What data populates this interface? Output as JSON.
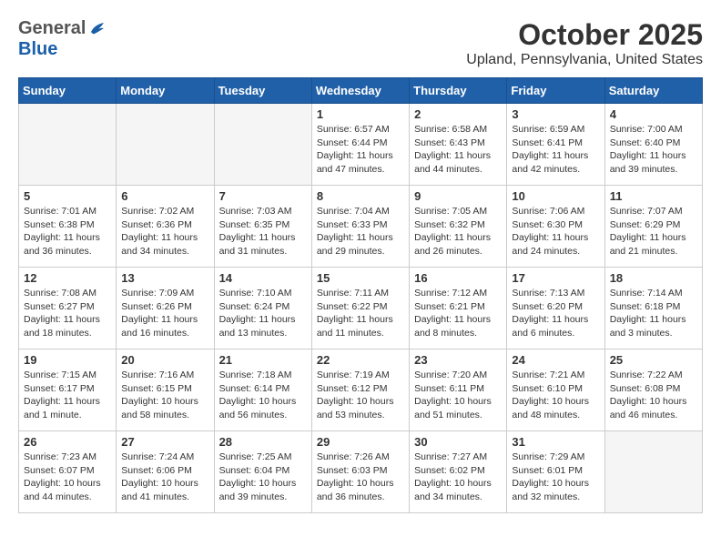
{
  "header": {
    "logo_general": "General",
    "logo_blue": "Blue",
    "month_title": "October 2025",
    "location": "Upland, Pennsylvania, United States"
  },
  "days_of_week": [
    "Sunday",
    "Monday",
    "Tuesday",
    "Wednesday",
    "Thursday",
    "Friday",
    "Saturday"
  ],
  "weeks": [
    [
      {
        "day": "",
        "info": ""
      },
      {
        "day": "",
        "info": ""
      },
      {
        "day": "",
        "info": ""
      },
      {
        "day": "1",
        "info": "Sunrise: 6:57 AM\nSunset: 6:44 PM\nDaylight: 11 hours\nand 47 minutes."
      },
      {
        "day": "2",
        "info": "Sunrise: 6:58 AM\nSunset: 6:43 PM\nDaylight: 11 hours\nand 44 minutes."
      },
      {
        "day": "3",
        "info": "Sunrise: 6:59 AM\nSunset: 6:41 PM\nDaylight: 11 hours\nand 42 minutes."
      },
      {
        "day": "4",
        "info": "Sunrise: 7:00 AM\nSunset: 6:40 PM\nDaylight: 11 hours\nand 39 minutes."
      }
    ],
    [
      {
        "day": "5",
        "info": "Sunrise: 7:01 AM\nSunset: 6:38 PM\nDaylight: 11 hours\nand 36 minutes."
      },
      {
        "day": "6",
        "info": "Sunrise: 7:02 AM\nSunset: 6:36 PM\nDaylight: 11 hours\nand 34 minutes."
      },
      {
        "day": "7",
        "info": "Sunrise: 7:03 AM\nSunset: 6:35 PM\nDaylight: 11 hours\nand 31 minutes."
      },
      {
        "day": "8",
        "info": "Sunrise: 7:04 AM\nSunset: 6:33 PM\nDaylight: 11 hours\nand 29 minutes."
      },
      {
        "day": "9",
        "info": "Sunrise: 7:05 AM\nSunset: 6:32 PM\nDaylight: 11 hours\nand 26 minutes."
      },
      {
        "day": "10",
        "info": "Sunrise: 7:06 AM\nSunset: 6:30 PM\nDaylight: 11 hours\nand 24 minutes."
      },
      {
        "day": "11",
        "info": "Sunrise: 7:07 AM\nSunset: 6:29 PM\nDaylight: 11 hours\nand 21 minutes."
      }
    ],
    [
      {
        "day": "12",
        "info": "Sunrise: 7:08 AM\nSunset: 6:27 PM\nDaylight: 11 hours\nand 18 minutes."
      },
      {
        "day": "13",
        "info": "Sunrise: 7:09 AM\nSunset: 6:26 PM\nDaylight: 11 hours\nand 16 minutes."
      },
      {
        "day": "14",
        "info": "Sunrise: 7:10 AM\nSunset: 6:24 PM\nDaylight: 11 hours\nand 13 minutes."
      },
      {
        "day": "15",
        "info": "Sunrise: 7:11 AM\nSunset: 6:22 PM\nDaylight: 11 hours\nand 11 minutes."
      },
      {
        "day": "16",
        "info": "Sunrise: 7:12 AM\nSunset: 6:21 PM\nDaylight: 11 hours\nand 8 minutes."
      },
      {
        "day": "17",
        "info": "Sunrise: 7:13 AM\nSunset: 6:20 PM\nDaylight: 11 hours\nand 6 minutes."
      },
      {
        "day": "18",
        "info": "Sunrise: 7:14 AM\nSunset: 6:18 PM\nDaylight: 11 hours\nand 3 minutes."
      }
    ],
    [
      {
        "day": "19",
        "info": "Sunrise: 7:15 AM\nSunset: 6:17 PM\nDaylight: 11 hours\nand 1 minute."
      },
      {
        "day": "20",
        "info": "Sunrise: 7:16 AM\nSunset: 6:15 PM\nDaylight: 10 hours\nand 58 minutes."
      },
      {
        "day": "21",
        "info": "Sunrise: 7:18 AM\nSunset: 6:14 PM\nDaylight: 10 hours\nand 56 minutes."
      },
      {
        "day": "22",
        "info": "Sunrise: 7:19 AM\nSunset: 6:12 PM\nDaylight: 10 hours\nand 53 minutes."
      },
      {
        "day": "23",
        "info": "Sunrise: 7:20 AM\nSunset: 6:11 PM\nDaylight: 10 hours\nand 51 minutes."
      },
      {
        "day": "24",
        "info": "Sunrise: 7:21 AM\nSunset: 6:10 PM\nDaylight: 10 hours\nand 48 minutes."
      },
      {
        "day": "25",
        "info": "Sunrise: 7:22 AM\nSunset: 6:08 PM\nDaylight: 10 hours\nand 46 minutes."
      }
    ],
    [
      {
        "day": "26",
        "info": "Sunrise: 7:23 AM\nSunset: 6:07 PM\nDaylight: 10 hours\nand 44 minutes."
      },
      {
        "day": "27",
        "info": "Sunrise: 7:24 AM\nSunset: 6:06 PM\nDaylight: 10 hours\nand 41 minutes."
      },
      {
        "day": "28",
        "info": "Sunrise: 7:25 AM\nSunset: 6:04 PM\nDaylight: 10 hours\nand 39 minutes."
      },
      {
        "day": "29",
        "info": "Sunrise: 7:26 AM\nSunset: 6:03 PM\nDaylight: 10 hours\nand 36 minutes."
      },
      {
        "day": "30",
        "info": "Sunrise: 7:27 AM\nSunset: 6:02 PM\nDaylight: 10 hours\nand 34 minutes."
      },
      {
        "day": "31",
        "info": "Sunrise: 7:29 AM\nSunset: 6:01 PM\nDaylight: 10 hours\nand 32 minutes."
      },
      {
        "day": "",
        "info": ""
      }
    ]
  ]
}
